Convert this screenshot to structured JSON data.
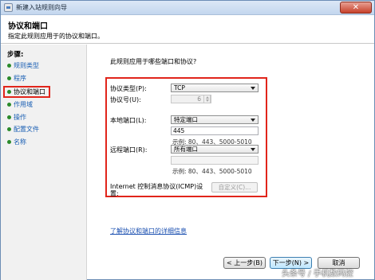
{
  "window": {
    "title": "新建入站规则向导",
    "close_symbol": "✕"
  },
  "header": {
    "title": "协议和端口",
    "subtitle": "指定此规则应用于的协议和端口。"
  },
  "sidebar": {
    "title": "步骤:",
    "items": [
      {
        "label": "规则类型",
        "active": false
      },
      {
        "label": "程序",
        "active": false
      },
      {
        "label": "协议和端口",
        "active": true
      },
      {
        "label": "作用域",
        "active": false
      },
      {
        "label": "操作",
        "active": false
      },
      {
        "label": "配置文件",
        "active": false
      },
      {
        "label": "名称",
        "active": false
      }
    ]
  },
  "main": {
    "question": "此规则应用于哪些端口和协议?",
    "protocol_type": {
      "label": "协议类型(P):",
      "value": "TCP"
    },
    "protocol_number": {
      "label": "协议号(U):",
      "value": "6"
    },
    "local_port": {
      "label": "本地端口(L):",
      "value": "特定端口",
      "input_value": "445",
      "example": "示例: 80、443、5000-5010"
    },
    "remote_port": {
      "label": "远程端口(R):",
      "value": "所有端口",
      "input_value": "",
      "example": "示例: 80、443、5000-5010"
    },
    "icmp": {
      "label_line1": "Internet 控制消息协议(ICMP)设",
      "label_line2": "置:",
      "button": "自定义(C)..."
    },
    "help_link": "了解协议和端口的详细信息"
  },
  "footer": {
    "back": "< 上一步(B)",
    "next": "下一步(N) >",
    "cancel": "取消"
  },
  "watermark": "头条号 / 手机数码控",
  "colors": {
    "highlight_red": "#e1251b",
    "link_blue": "#1a4fb0",
    "step_dot_green": "#2a8a2a"
  }
}
